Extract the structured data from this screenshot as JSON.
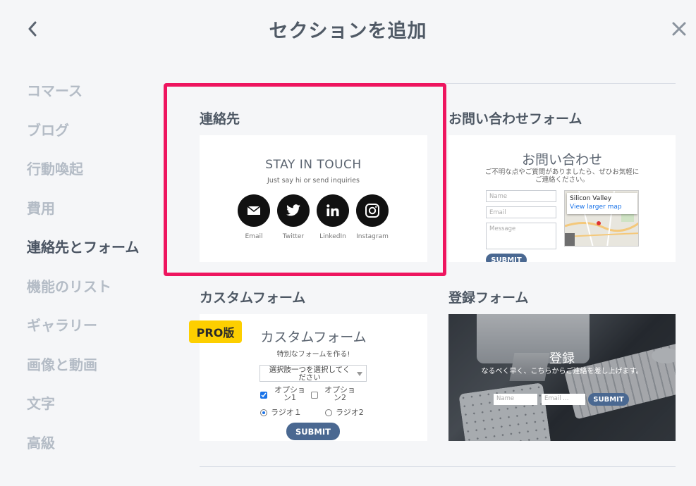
{
  "header": {
    "title": "セクションを追加"
  },
  "sidebar": {
    "items": [
      {
        "label": "コマース"
      },
      {
        "label": "ブログ"
      },
      {
        "label": "行動喚起"
      },
      {
        "label": "費用"
      },
      {
        "label": "連絡先とフォーム",
        "active": true
      },
      {
        "label": "機能のリスト"
      },
      {
        "label": "ギャラリー"
      },
      {
        "label": "画像と動画"
      },
      {
        "label": "文字"
      },
      {
        "label": "高級"
      }
    ]
  },
  "sections": {
    "contact": {
      "title": "連絡先",
      "heading": "STAY IN TOUCH",
      "subheading": "Just say hi or send inquiries",
      "socials": [
        {
          "label": "Email",
          "icon": "mail-icon"
        },
        {
          "label": "Twitter",
          "icon": "twitter-icon"
        },
        {
          "label": "LinkedIn",
          "icon": "linkedin-icon"
        },
        {
          "label": "Instagram",
          "icon": "instagram-icon"
        }
      ]
    },
    "inquiry": {
      "title": "お問い合わせフォーム",
      "heading": "お問い合わせ",
      "description": "ご不明な点やご質問がありましたら、ぜひお気軽にご連絡ください。",
      "name_placeholder": "Name",
      "email_placeholder": "Email",
      "message_placeholder": "Message",
      "map_place": "Silicon Valley",
      "map_link": "View larger map",
      "submit": "SUBMIT"
    },
    "custom": {
      "title": "カスタムフォーム",
      "badge": "PRO版",
      "heading": "カスタムフォーム",
      "subheading": "特別なフォームを作る!",
      "select_text": "選択肢一つを選択してください",
      "option1": "オプション1",
      "option2": "オプション2",
      "radio1": "ラジオ１",
      "radio2": "ラジオ2",
      "submit": "SUBMIT"
    },
    "register": {
      "title": "登録フォーム",
      "heading": "登録",
      "description": "なるべく早く、こちらからご連絡を差し上げます。",
      "name_placeholder": "Name",
      "email_placeholder": "Email ...",
      "submit": "SUBMIT"
    }
  },
  "colors": {
    "highlight": "#ee155f",
    "pro_badge": "#fdcf00",
    "submit": "#4a6891"
  }
}
